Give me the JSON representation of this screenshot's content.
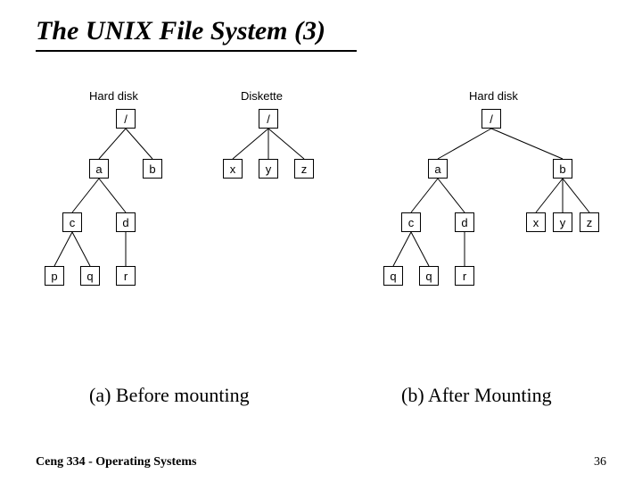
{
  "title": "The UNIX File System (3)",
  "captions": {
    "before": "(a) Before mounting",
    "after": "(b) After Mounting"
  },
  "footer": "Ceng 334 - Operating Systems",
  "page": "36",
  "labels": {
    "harddisk": "Hard disk",
    "diskette": "Diskette"
  },
  "nodes": {
    "root": "/",
    "a": "a",
    "b": "b",
    "c": "c",
    "d": "d",
    "p": "p",
    "q": "q",
    "r": "r",
    "x": "x",
    "y": "y",
    "z": "z"
  },
  "trees": {
    "before_hard": {
      "label_key": "harddisk",
      "structure": {
        "root": [
          "a",
          "b"
        ],
        "a": [
          "c",
          "d"
        ],
        "c": [
          "p",
          "q"
        ],
        "d": [
          "r"
        ]
      }
    },
    "diskette": {
      "label_key": "diskette",
      "structure": {
        "root": [
          "x",
          "y",
          "z"
        ]
      }
    },
    "after_hard": {
      "label_key": "harddisk",
      "structure": {
        "root": [
          "a",
          "b"
        ],
        "a": [
          "c",
          "d"
        ],
        "b": [
          "x",
          "y",
          "z"
        ],
        "c": [
          "q",
          "q2"
        ],
        "d": [
          "r"
        ]
      },
      "node_aliases": {
        "q2": "q"
      }
    }
  }
}
